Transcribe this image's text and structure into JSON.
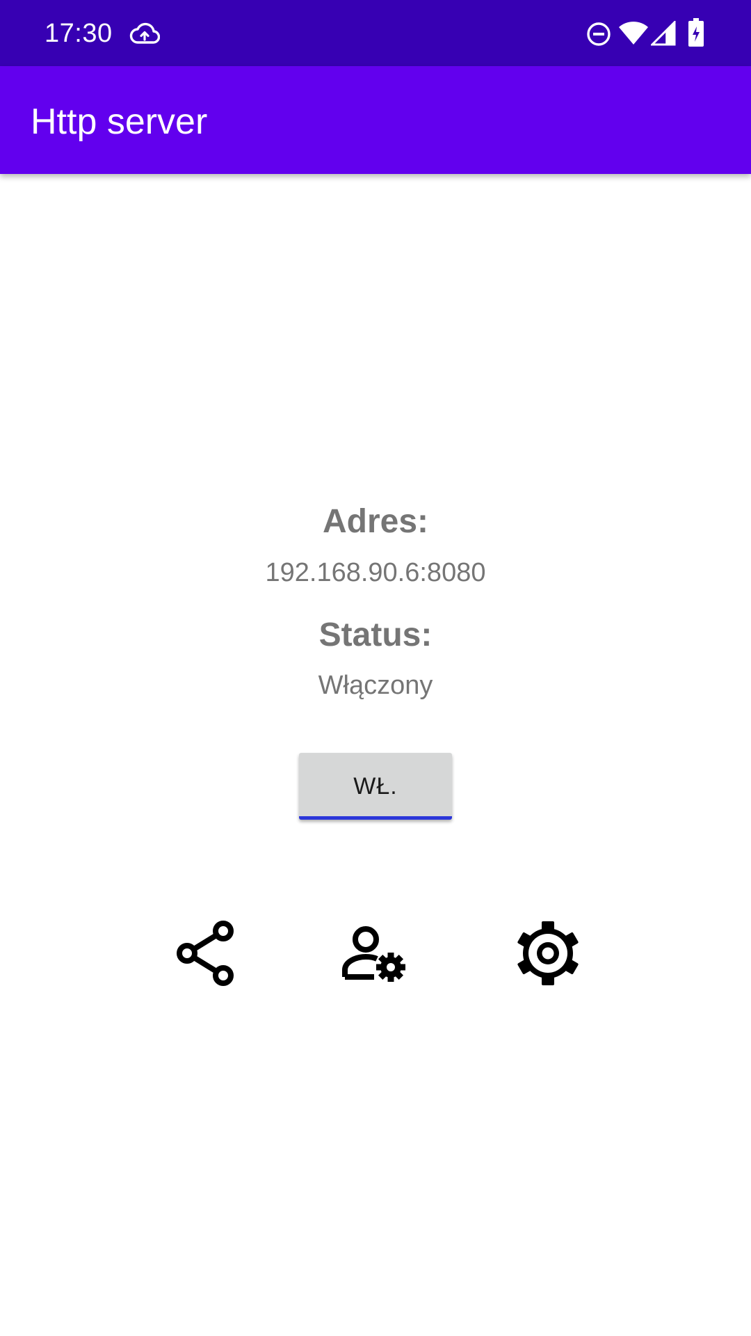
{
  "status_bar": {
    "time": "17:30",
    "icons": [
      "cloud-upload-icon",
      "do-not-disturb-icon",
      "wifi-icon",
      "cellular-signal-icon",
      "battery-charging-icon"
    ],
    "background": "#3700b3"
  },
  "app_bar": {
    "title": "Http server",
    "background": "#6200ee"
  },
  "server": {
    "address_label": "Adres:",
    "address_value": "192.168.90.6:8080",
    "status_label": "Status:",
    "status_value": "Włączony"
  },
  "toggle": {
    "label": "WŁ.",
    "background": "#d6d7d7",
    "underline_color": "#2b36d9"
  },
  "actions": {
    "icons": [
      "share-icon",
      "user-settings-icon",
      "settings-gear-icon"
    ]
  }
}
